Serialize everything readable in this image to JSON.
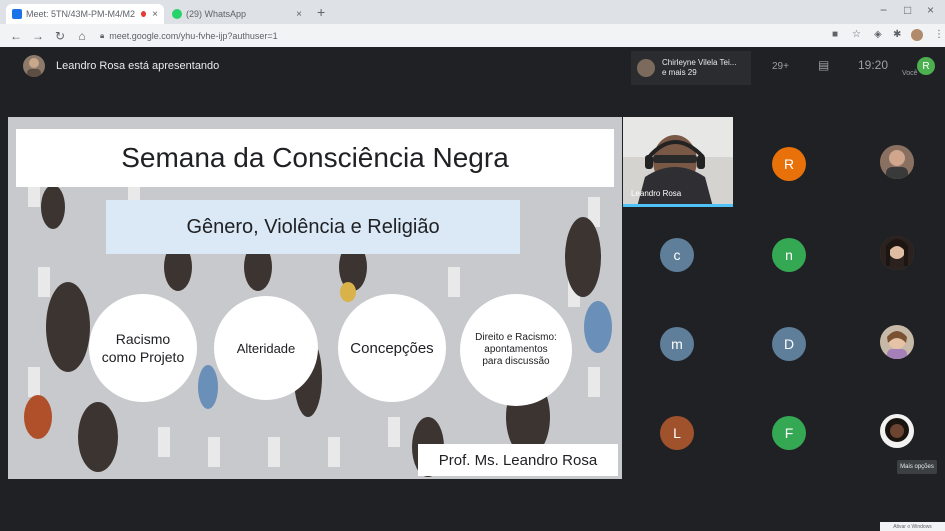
{
  "browser": {
    "tabs": [
      {
        "label": "Meet: 5TN/43M-PM-M4/M2",
        "icon_color": "#1a73e8",
        "dot_color": "#e53935"
      },
      {
        "label": "(29) WhatsApp",
        "icon_color": "#25d366"
      }
    ],
    "new_tab": "+",
    "url": "meet.google.com/yhu-fvhe-ijp?authuser=1",
    "win": {
      "min": "−",
      "max": "□",
      "close": "×"
    }
  },
  "meet": {
    "presenter_banner": "Leandro Rosa está apresentando",
    "people_preview": {
      "name": "Chirleyne Vilela Tei...",
      "more": "e mais 29"
    },
    "participant_count": "29+",
    "clock": "19:20",
    "you_label": "Você",
    "self_initial": "R",
    "more_options": "Mais opções"
  },
  "slide": {
    "title": "Semana da Consciência Negra",
    "subtitle": "Gênero, Violência e Religião",
    "topics": [
      {
        "line1": "Racismo",
        "line2": "como Projeto"
      },
      {
        "line1": "Alteridade"
      },
      {
        "line1": "Concepções"
      },
      {
        "line1": "Direito e Racismo:",
        "line2": "apontamentos",
        "line3": "para discussão"
      }
    ],
    "author": "Prof. Ms. Leandro Rosa"
  },
  "participants": {
    "camera_tile_name": "Leandro Rosa",
    "initials": [
      {
        "letter": "R",
        "color": "#e8710a"
      },
      {
        "letter": "c",
        "color": "#5f7e99"
      },
      {
        "letter": "n",
        "color": "#34a853"
      },
      {
        "letter": "m",
        "color": "#5f7e99"
      },
      {
        "letter": "D",
        "color": "#5f7e99"
      },
      {
        "letter": "L",
        "color": "#a0522d"
      },
      {
        "letter": "F",
        "color": "#34a853"
      }
    ]
  },
  "icons": [
    "back-icon",
    "forward-icon",
    "reload-icon",
    "home-icon",
    "lock-icon",
    "people-icon",
    "chat-icon"
  ],
  "footer_note": "Ativar o Windows"
}
